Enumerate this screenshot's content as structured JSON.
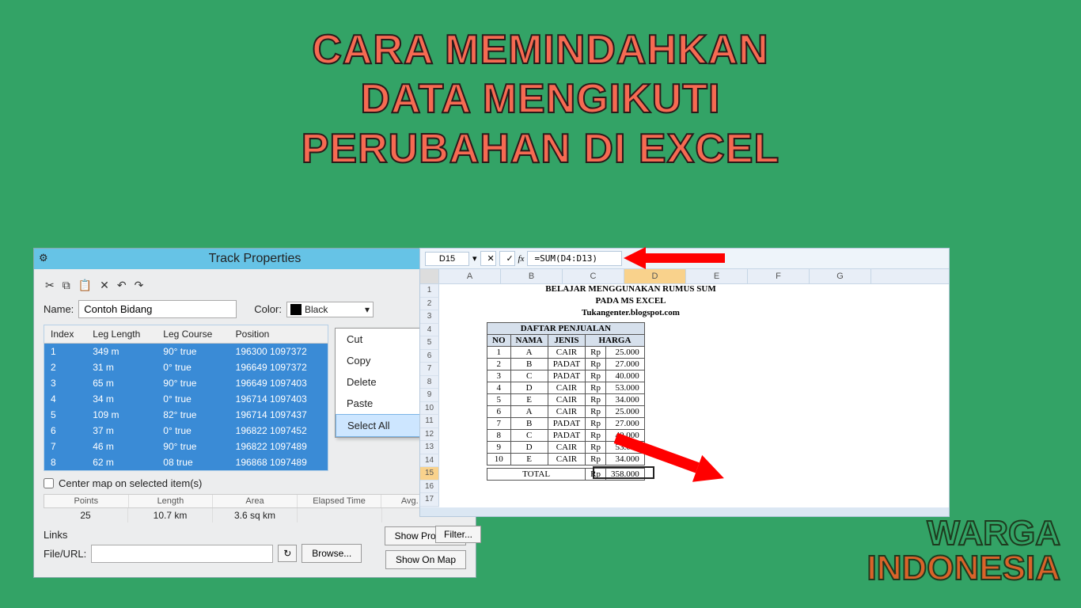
{
  "headline": {
    "l1": "CARA MEMINDAHKAN",
    "l2": "DATA MENGIKUTI",
    "l3": "PERUBAHAN DI EXCEL"
  },
  "track": {
    "title": "Track Properties",
    "name_label": "Name:",
    "name_value": "Contoh Bidang",
    "color_label": "Color:",
    "color_value": "Black",
    "cols": {
      "c1": "Index",
      "c2": "Leg Length",
      "c3": "Leg Course",
      "c4": "Position"
    },
    "rows": [
      {
        "i": "1",
        "len": "349 m",
        "crs": "90° true",
        "pos": "196300 1097372"
      },
      {
        "i": "2",
        "len": "31 m",
        "crs": "0° true",
        "pos": "196649 1097372"
      },
      {
        "i": "3",
        "len": "65 m",
        "crs": "90° true",
        "pos": "196649 1097403"
      },
      {
        "i": "4",
        "len": "34 m",
        "crs": "0° true",
        "pos": "196714 1097403"
      },
      {
        "i": "5",
        "len": "109 m",
        "crs": "82° true",
        "pos": "196714 1097437"
      },
      {
        "i": "6",
        "len": "37 m",
        "crs": "0° true",
        "pos": "196822 1097452"
      },
      {
        "i": "7",
        "len": "46 m",
        "crs": "90° true",
        "pos": "196822 1097489"
      },
      {
        "i": "8",
        "len": "62 m",
        "crs": "08 true",
        "pos": "196868 1097489"
      }
    ],
    "ctx": {
      "cut": "Cut",
      "copy": "Copy",
      "del": "Delete",
      "paste": "Paste",
      "selall": "Select All"
    },
    "centermap": "Center map on selected item(s)",
    "stats": {
      "points": {
        "h": "Points",
        "v": "25"
      },
      "length": {
        "h": "Length",
        "v": "10.7 km"
      },
      "area": {
        "h": "Area",
        "v": "3.6 sq km"
      },
      "elapsed": {
        "h": "Elapsed Time",
        "v": ""
      },
      "avg": {
        "h": "Avg. Speed",
        "v": ""
      }
    },
    "links": "Links",
    "fileurl_label": "File/URL:",
    "browse": "Browse...",
    "filter": "Filter...",
    "showprofile": "Show Profile...",
    "showonmap": "Show On Map"
  },
  "excel": {
    "cellname": "D15",
    "fx": "fx",
    "formula": "=SUM(D4:D13)",
    "cols": [
      "A",
      "B",
      "C",
      "D",
      "E",
      "F",
      "G"
    ],
    "t1": "BELAJAR MENGGUNAKAN RUMUS SUM",
    "t2": "PADA MS EXCEL",
    "t3": "Tukangenter.blogspot.com",
    "tablehead": "DAFTAR PENJUALAN",
    "h": {
      "no": "NO",
      "nama": "NAMA",
      "jenis": "JENIS",
      "harga": "HARGA"
    },
    "rows": [
      {
        "no": "1",
        "n": "A",
        "j": "CAIR",
        "rp": "Rp",
        "a": "25.000"
      },
      {
        "no": "2",
        "n": "B",
        "j": "PADAT",
        "rp": "Rp",
        "a": "27.000"
      },
      {
        "no": "3",
        "n": "C",
        "j": "PADAT",
        "rp": "Rp",
        "a": "40.000"
      },
      {
        "no": "4",
        "n": "D",
        "j": "CAIR",
        "rp": "Rp",
        "a": "53.000"
      },
      {
        "no": "5",
        "n": "E",
        "j": "CAIR",
        "rp": "Rp",
        "a": "34.000"
      },
      {
        "no": "6",
        "n": "A",
        "j": "CAIR",
        "rp": "Rp",
        "a": "25.000"
      },
      {
        "no": "7",
        "n": "B",
        "j": "PADAT",
        "rp": "Rp",
        "a": "27.000"
      },
      {
        "no": "8",
        "n": "C",
        "j": "PADAT",
        "rp": "Rp",
        "a": "40.000"
      },
      {
        "no": "9",
        "n": "D",
        "j": "CAIR",
        "rp": "Rp",
        "a": "53.000"
      },
      {
        "no": "10",
        "n": "E",
        "j": "CAIR",
        "rp": "Rp",
        "a": "34.000"
      }
    ],
    "total_label": "TOTAL",
    "total_rp": "Rp",
    "total_amt": "358.000"
  },
  "watermark": {
    "l1": "WARGA",
    "l2": "INDONESIA"
  }
}
